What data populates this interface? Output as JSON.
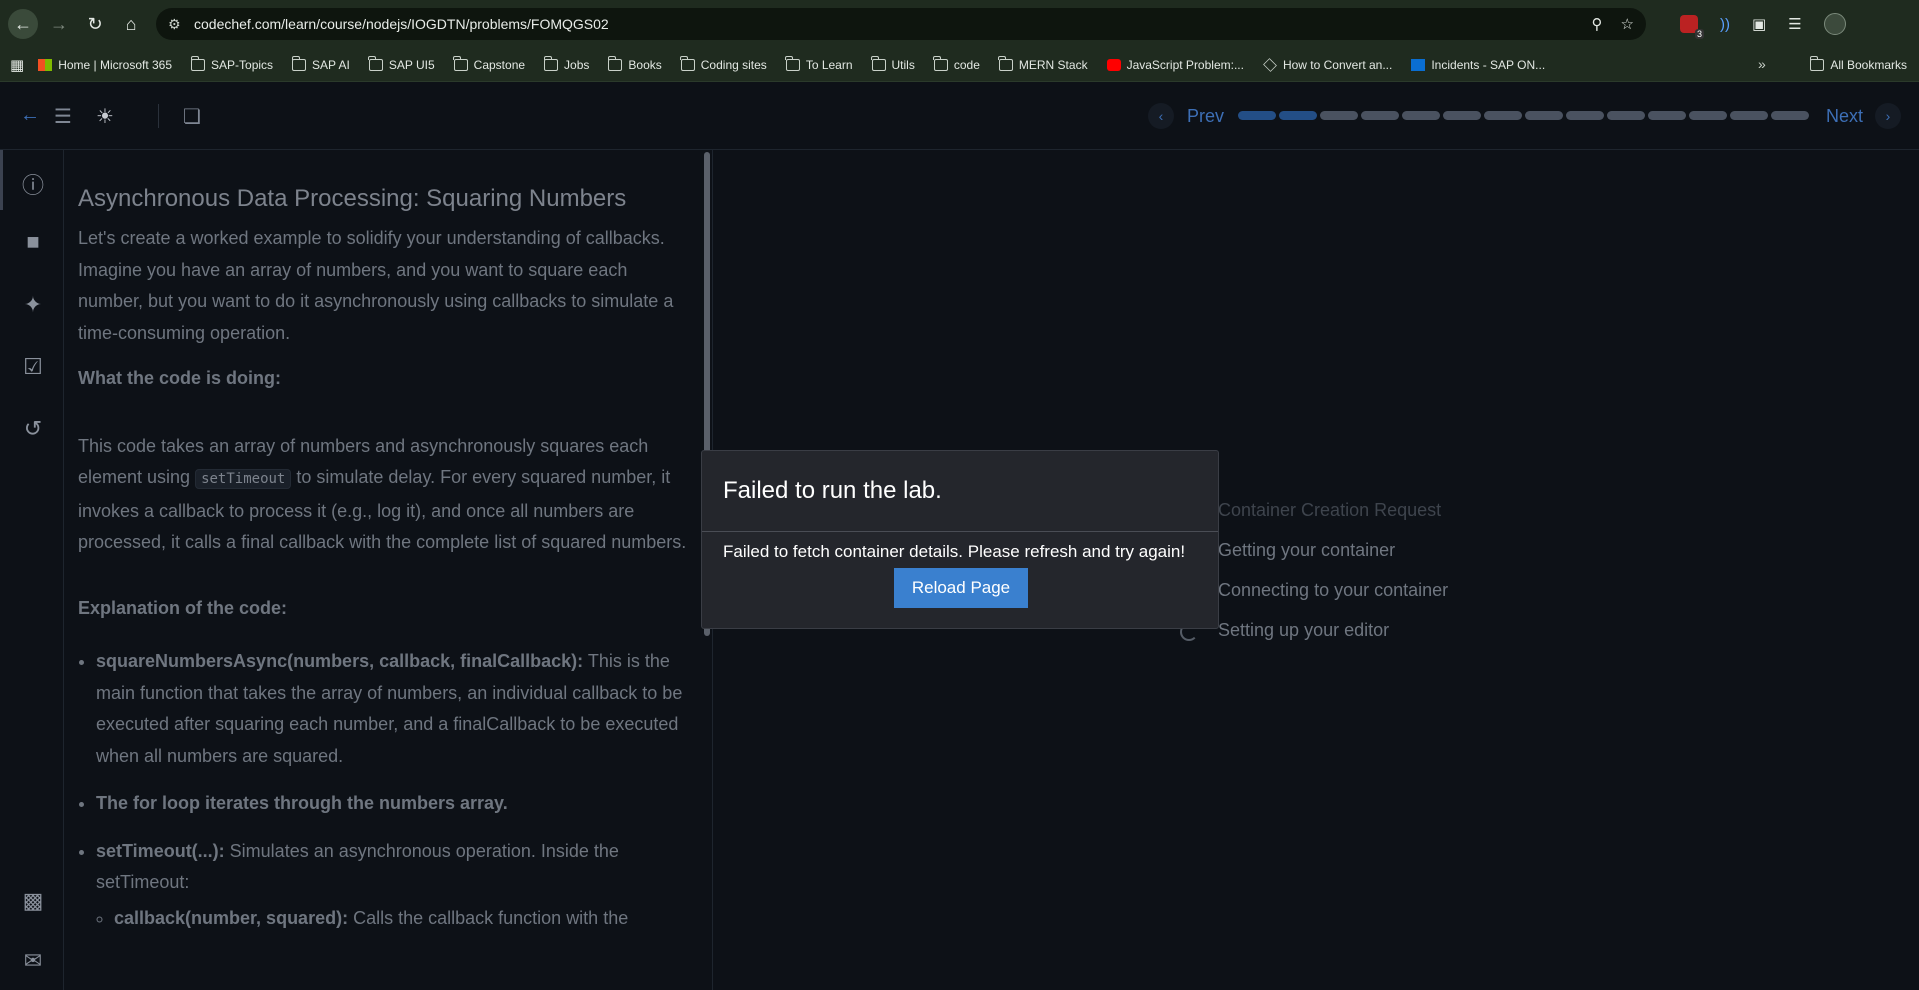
{
  "browser": {
    "url": "codechef.com/learn/course/nodejs/IOGDTN/problems/FOMQGS02",
    "extension_badge": "3",
    "bookmarks": [
      {
        "label": "Home | Microsoft 365",
        "icon": "microsoft-icon"
      },
      {
        "label": "SAP-Topics",
        "icon": "folder-icon"
      },
      {
        "label": "SAP AI",
        "icon": "folder-icon"
      },
      {
        "label": "SAP UI5",
        "icon": "folder-icon"
      },
      {
        "label": "Capstone",
        "icon": "folder-icon"
      },
      {
        "label": "Jobs",
        "icon": "folder-icon"
      },
      {
        "label": "Books",
        "icon": "folder-icon"
      },
      {
        "label": "Coding sites",
        "icon": "folder-icon"
      },
      {
        "label": "To Learn",
        "icon": "folder-icon"
      },
      {
        "label": "Utils",
        "icon": "folder-icon"
      },
      {
        "label": "code",
        "icon": "folder-icon"
      },
      {
        "label": "MERN Stack",
        "icon": "folder-icon"
      },
      {
        "label": "JavaScript Problem:...",
        "icon": "youtube-icon"
      },
      {
        "label": "How to Convert an...",
        "icon": "cube-icon"
      },
      {
        "label": "Incidents - SAP ON...",
        "icon": "sap-icon"
      }
    ],
    "all_bookmarks": "All Bookmarks"
  },
  "header": {
    "prev_label": "Prev",
    "next_label": "Next",
    "progress_total": 14,
    "progress_done": 2
  },
  "problem": {
    "title": "Asynchronous Data Processing: Squaring Numbers",
    "intro": "Let's create a worked example to solidify your understanding of callbacks. Imagine you have an array of numbers, and you want to square each number, but you want to do it asynchronously using callbacks to simulate a time-consuming operation.",
    "what_heading": "What the code is doing:",
    "what_pre": "This code takes an array of numbers and asynchronously squares each element using ",
    "what_code": "setTimeout",
    "what_post": " to simulate delay. For every squared number, it invokes a callback to process it (e.g., log it), and once all numbers are processed, it calls a final callback with the complete list of squared numbers.",
    "explanation_heading": "Explanation of the code:",
    "bullets": [
      {
        "bold": "squareNumbersAsync(numbers, callback, finalCallback):",
        "text": " This is the main function that takes the array of numbers, an individual callback to be executed after squaring each number, and a finalCallback to be executed when all numbers are squared."
      },
      {
        "bold": "The for loop iterates through the numbers array.",
        "text": ""
      },
      {
        "bold": "setTimeout(...):",
        "text": " Simulates an asynchronous operation. Inside the setTimeout:"
      }
    ],
    "sub_bullet": {
      "bold": "callback(number, squared):",
      "text": " Calls the callback function with the"
    }
  },
  "status_steps": [
    "Container Creation Request",
    "Getting your container",
    "Connecting to your container",
    "Setting up your editor"
  ],
  "modal": {
    "title": "Failed to run the lab.",
    "message": "Failed to fetch container details. Please refresh and try again!",
    "button": "Reload Page"
  },
  "colors": {
    "accent": "#3a80cf",
    "progress_done": "#234e86",
    "progress_todo": "#4a5260"
  }
}
